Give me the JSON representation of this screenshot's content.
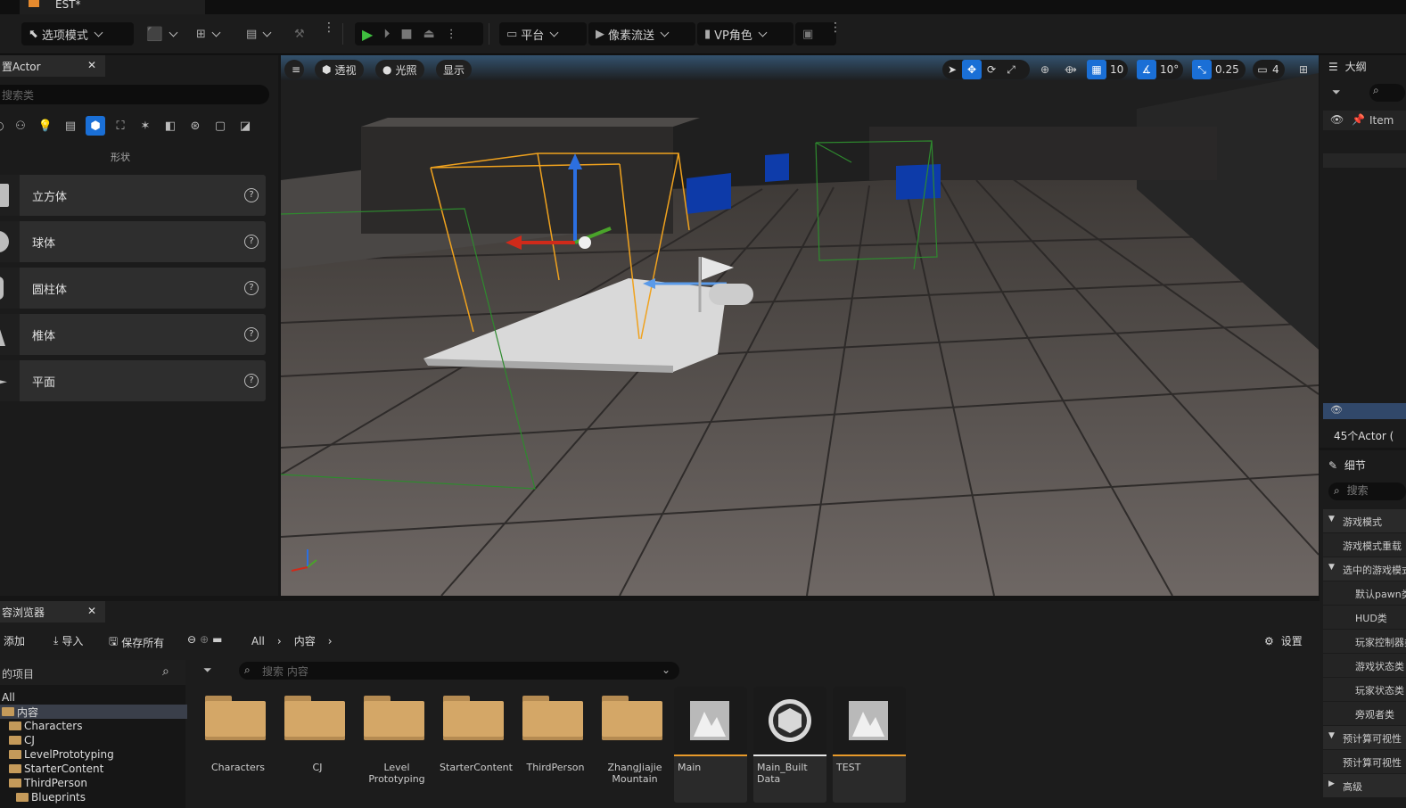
{
  "window": {
    "tab_title": "EST*"
  },
  "toolbar": {
    "mode_label": "选项模式",
    "platform_label": "平台",
    "pixel_stream_label": "像素流送",
    "vp_role_label": "VP角色"
  },
  "left_panel": {
    "tab_title": "置Actor",
    "search_placeholder": "搜索类",
    "category_label": "形状",
    "items": [
      {
        "label": "立方体"
      },
      {
        "label": "球体"
      },
      {
        "label": "圆柱体"
      },
      {
        "label": "椎体"
      },
      {
        "label": "平面"
      }
    ]
  },
  "viewport": {
    "perspective_label": "透视",
    "lighting_label": "光照",
    "show_label": "显示",
    "grid_snap": "10",
    "rotation_snap": "10°",
    "scale_snap": "0.25",
    "camera_speed": "4"
  },
  "outliner": {
    "title": "大纲",
    "column_label": "Item",
    "actor_count": "45个Actor ("
  },
  "details": {
    "title": "细节",
    "search_placeholder": "搜索",
    "rows": [
      {
        "label": "游戏模式",
        "type": "section"
      },
      {
        "label": "游戏模式重载",
        "type": "row"
      },
      {
        "label": "选中的游戏模式",
        "type": "section"
      },
      {
        "label": "默认pawn类",
        "type": "row"
      },
      {
        "label": "HUD类",
        "type": "row"
      },
      {
        "label": "玩家控制器类",
        "type": "row"
      },
      {
        "label": "游戏状态类",
        "type": "row"
      },
      {
        "label": "玩家状态类",
        "type": "row"
      },
      {
        "label": "旁观者类",
        "type": "row"
      },
      {
        "label": "预计算可视性",
        "type": "section"
      },
      {
        "label": "预计算可视性",
        "type": "row"
      },
      {
        "label": "高级",
        "type": "section-collapsed"
      }
    ]
  },
  "content_browser": {
    "tab_title": "容浏览器",
    "add_label": "添加",
    "import_label": "导入",
    "save_all_label": "保存所有",
    "path": [
      "All",
      "内容"
    ],
    "settings_label": "设置",
    "tree_header": "的项目",
    "search_placeholder": "搜索 内容",
    "tree": [
      {
        "label": "All",
        "indent": 0,
        "folder": false,
        "selected": false
      },
      {
        "label": "内容",
        "indent": 0,
        "folder": true,
        "selected": true
      },
      {
        "label": "Characters",
        "indent": 1,
        "folder": true,
        "selected": false
      },
      {
        "label": "CJ",
        "indent": 1,
        "folder": true,
        "selected": false
      },
      {
        "label": "LevelPrototyping",
        "indent": 1,
        "folder": true,
        "selected": false
      },
      {
        "label": "StarterContent",
        "indent": 1,
        "folder": true,
        "selected": false
      },
      {
        "label": "ThirdPerson",
        "indent": 1,
        "folder": true,
        "selected": false
      },
      {
        "label": "Blueprints",
        "indent": 2,
        "folder": true,
        "selected": false
      }
    ],
    "folders": [
      {
        "name": "Characters"
      },
      {
        "name": "CJ"
      },
      {
        "name": "Level\nPrototyping"
      },
      {
        "name": "StarterContent"
      },
      {
        "name": "ThirdPerson"
      },
      {
        "name": "ZhangJiajie\nMountain"
      }
    ],
    "assets": [
      {
        "name": "Main",
        "kind": "level",
        "accent": "#e89a2a"
      },
      {
        "name": "Main_Built\nData",
        "kind": "data",
        "accent": "#e6e6e6"
      },
      {
        "name": "TEST",
        "kind": "level",
        "accent": "#e89a2a"
      }
    ]
  },
  "colors": {
    "accent_blue": "#1a6fd6",
    "play_green": "#3fbf3f",
    "level_orange": "#e89a2a"
  }
}
